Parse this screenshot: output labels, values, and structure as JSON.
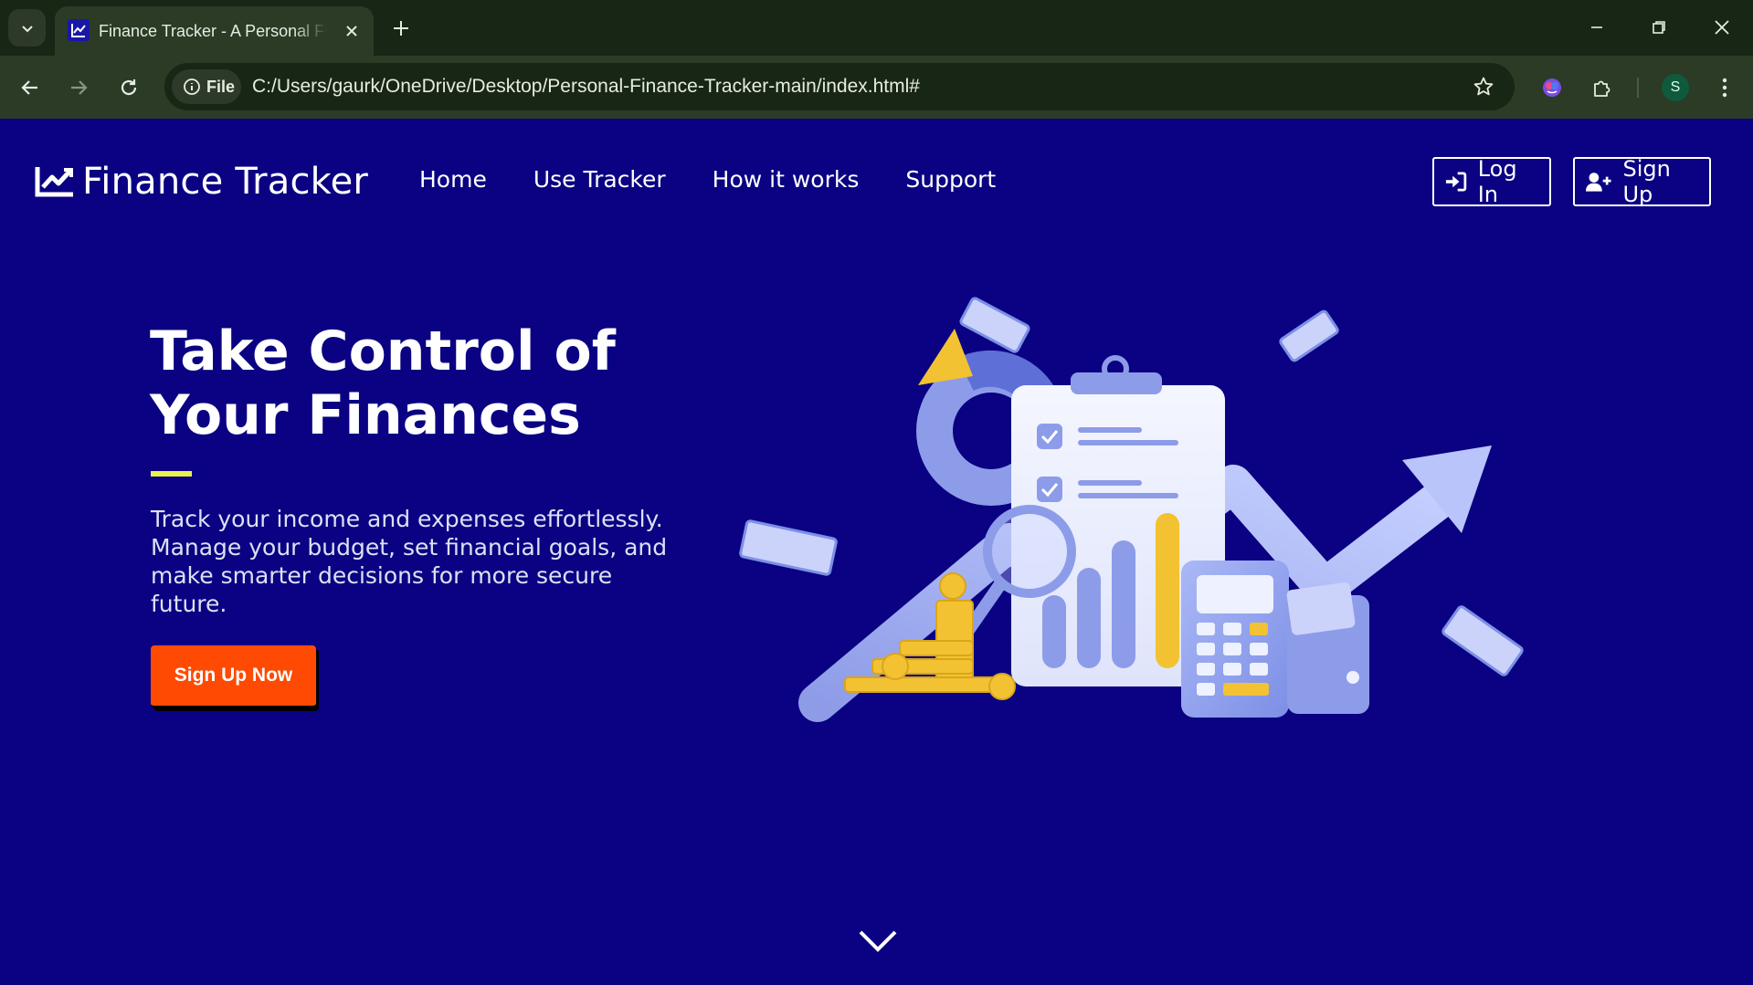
{
  "browser": {
    "tab_title": "Finance Tracker - A Personal Finance Tracker",
    "site_chip_label": "File",
    "url": "C:/Users/gaurk/OneDrive/Desktop/Personal-Finance-Tracker-main/index.html#",
    "profile_initial": "S",
    "icons": [
      "chevron-down-icon",
      "chart-favicon-icon",
      "close-icon",
      "plus-icon",
      "minimize-icon",
      "restore-icon",
      "close-window-icon",
      "back-arrow-icon",
      "forward-arrow-icon",
      "reload-icon",
      "info-icon",
      "star-icon",
      "extension-colored-icon",
      "puzzle-icon",
      "more-vert-icon"
    ]
  },
  "header": {
    "brand": "Finance Tracker",
    "nav": [
      "Home",
      "Use Tracker",
      "How it works",
      "Support"
    ],
    "login_label": "Log In",
    "signup_label": "Sign Up"
  },
  "hero": {
    "title_line1": "Take Control of",
    "title_line2": "Your Finances",
    "description": "Track your income and expenses effortlessly. Manage your budget, set financial goals, and make smarter decisions for more secure future.",
    "cta_label": "Sign Up Now"
  },
  "colors": {
    "background": "#0a0282",
    "accent_line": "#e8f24a",
    "cta": "#fe4a03",
    "browser_frame": "#182616",
    "toolbar": "#2b3b26"
  }
}
